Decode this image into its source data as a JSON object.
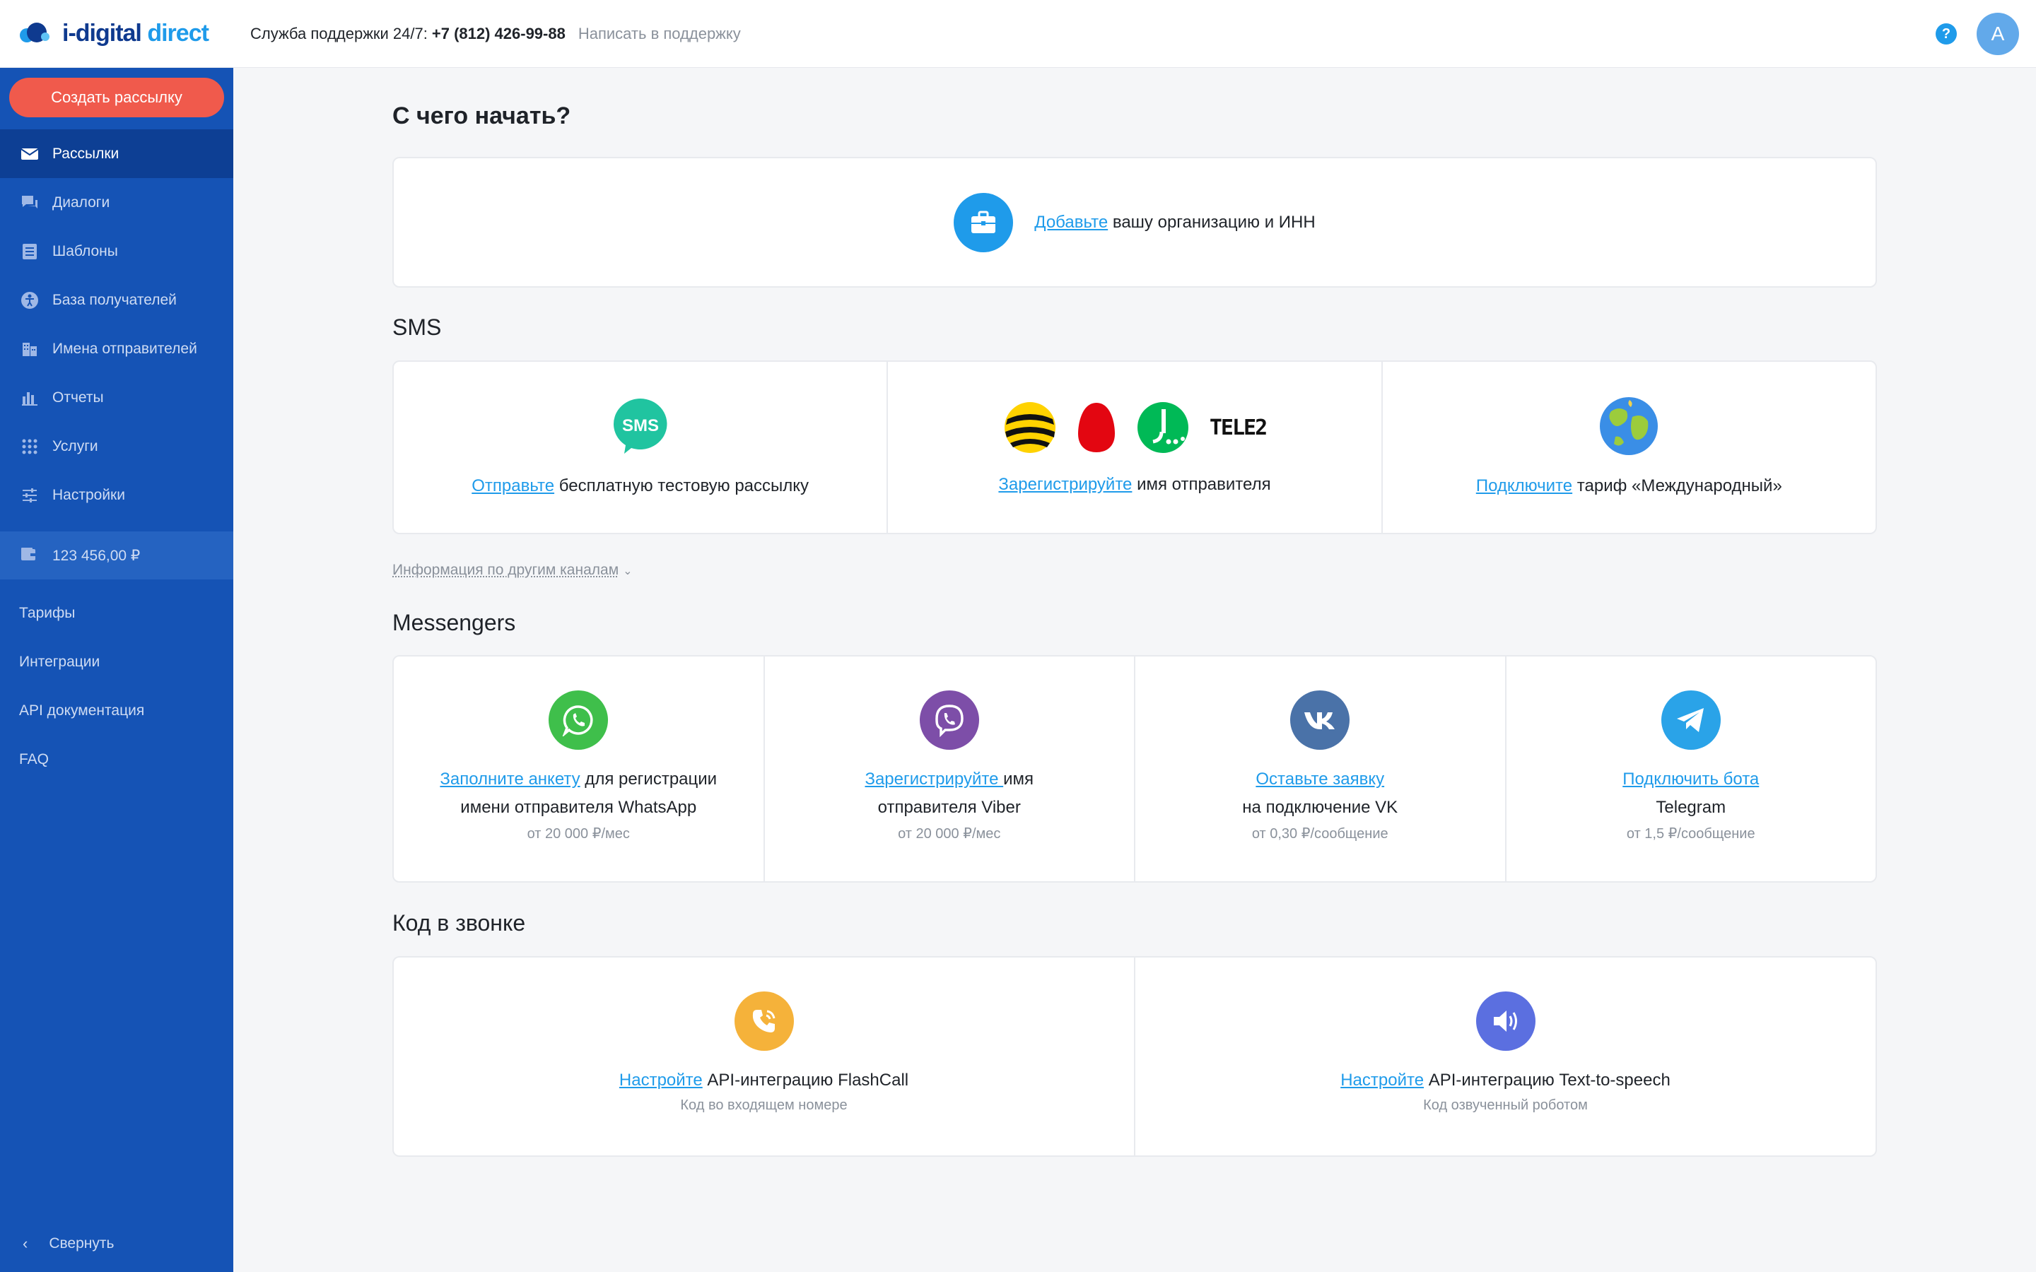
{
  "brand": {
    "name_part1": "i-digital",
    "name_part2": "direct"
  },
  "topbar": {
    "support_label": "Служба поддержки 24/7:",
    "support_phone": "+7 (812) 426-99-88",
    "support_link": "Написать в поддержку",
    "help_icon": "?",
    "avatar_letter": "A"
  },
  "sidebar": {
    "create_button": "Создать рассылку",
    "items": [
      {
        "label": "Рассылки",
        "icon": "envelope-icon"
      },
      {
        "label": "Диалоги",
        "icon": "chat-icon"
      },
      {
        "label": "Шаблоны",
        "icon": "template-icon"
      },
      {
        "label": "База получателей",
        "icon": "accessibility-icon"
      },
      {
        "label": "Имена отправителей",
        "icon": "building-icon"
      },
      {
        "label": "Отчеты",
        "icon": "bar-chart-icon"
      },
      {
        "label": "Услуги",
        "icon": "grid-icon"
      },
      {
        "label": "Настройки",
        "icon": "sliders-icon"
      }
    ],
    "balance": "123 456,00 ₽",
    "links": [
      "Тарифы",
      "Интеграции",
      "API документация",
      "FAQ"
    ],
    "collapse": "Свернуть",
    "colors": {
      "background": "#1553b5",
      "active": "#0d3f94",
      "button": "#f05a4c"
    }
  },
  "main": {
    "title": "С чего начать?",
    "org": {
      "link": "Добавьте",
      "text": " вашу организацию и ИНН"
    },
    "sms": {
      "title": "SMS",
      "cells": [
        {
          "link": "Отправьте",
          "text": " бесплатную тестовую рассылку"
        },
        {
          "link": "Зарегистрируйте",
          "text": " имя отправителя",
          "operator_logo_text": "TELE2"
        },
        {
          "link": "Подключите",
          "text": " тариф «Международный»"
        }
      ]
    },
    "info_link": "Информация по другим каналам",
    "messengers": {
      "title": "Messengers",
      "cells": [
        {
          "link": "Заполните анкету",
          "text": " для регистрации",
          "line2": "имени отправителя WhatsApp",
          "price": "от 20 000 ₽/мес",
          "color": "#3fbf4b"
        },
        {
          "link": "Зарегистрируйте ",
          "text": "имя",
          "line2": "отправителя Viber",
          "price": "от 20 000 ₽/мес",
          "color": "#7d4ea8"
        },
        {
          "link": "Оставьте заявку",
          "text": "",
          "line2": "на подключение VK",
          "price": "от 0,30 ₽/сообщение",
          "color": "#4a72a8"
        },
        {
          "link": "Подключить бота",
          "text": "",
          "line2": "Telegram",
          "price": "от 1,5 ₽/сообщение",
          "color": "#2aa3e8"
        }
      ]
    },
    "call": {
      "title": "Код в звонке",
      "cells": [
        {
          "link": "Настройте",
          "text": " API-интеграцию FlashCall",
          "sub": "Код во входящем номере",
          "color": "#f5b23a"
        },
        {
          "link": "Настройте",
          "text": " API-интеграцию Text-to-speech",
          "sub": "Код озвученный роботом",
          "color": "#5b6fe0"
        }
      ]
    }
  }
}
